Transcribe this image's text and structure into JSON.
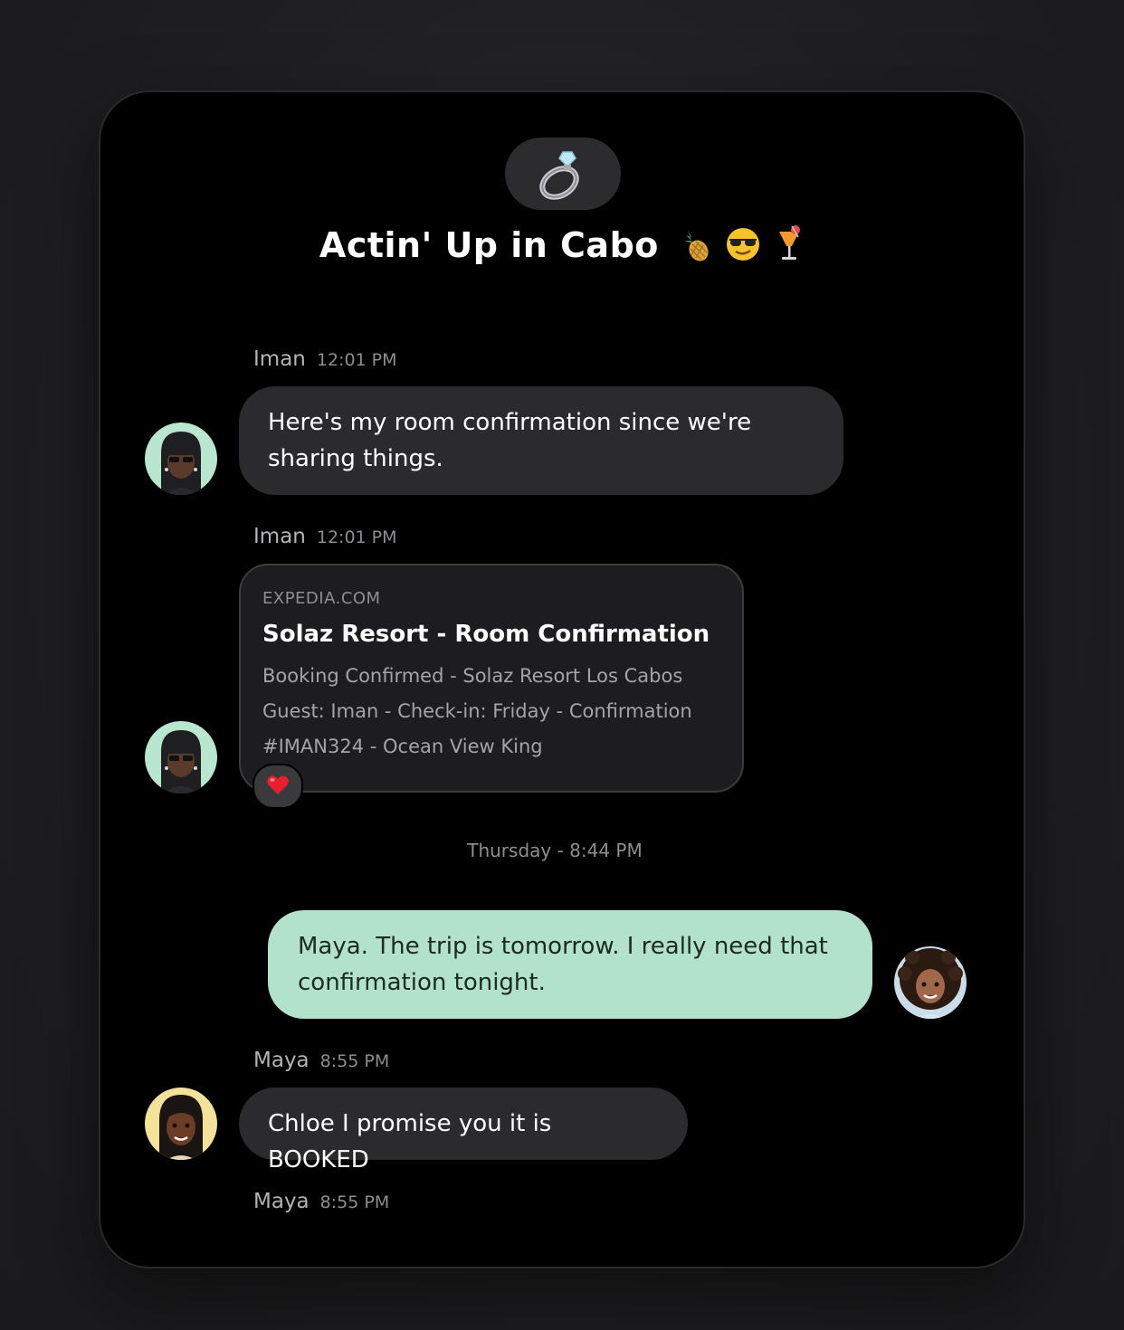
{
  "chat": {
    "group_icon": "ring-icon",
    "title": "Actin' Up in Cabo",
    "title_emojis": [
      "pineapple-icon",
      "sunglasses-face-icon",
      "tropical-drink-icon"
    ]
  },
  "messages": [
    {
      "sender": "Iman",
      "time": "12:01 PM",
      "direction": "incoming",
      "text_lines": [
        "Here's my room confirmation since we're",
        "sharing things."
      ]
    },
    {
      "sender": "Iman",
      "time": "12:01 PM",
      "direction": "incoming",
      "link_preview": {
        "source": "EXPEDIA.COM",
        "title": "Solaz Resort - Room Confirmation",
        "desc_lines": [
          "Booking Confirmed - Solaz Resort Los Cabos",
          "Guest: Iman - Check-in: Friday - Confirmation",
          "#IMAN324 - Ocean View King"
        ]
      },
      "reaction": "heart-icon"
    },
    {
      "day_separator": "Thursday - 8:44 PM"
    },
    {
      "direction": "outgoing",
      "text_lines": [
        "Maya. The trip is tomorrow. I really need that",
        "confirmation tonight."
      ]
    },
    {
      "sender": "Maya",
      "time": "8:55 PM",
      "direction": "incoming",
      "text": "Chloe I promise you it is BOOKED"
    },
    {
      "sender": "Maya",
      "time": "8:55 PM"
    }
  ],
  "colors": {
    "outgoing_bubble": "#b2e2cc",
    "incoming_bubble": "#2b2b2e",
    "iman_avatar_bg": "#b9e6cf",
    "maya_avatar_bg": "#f4e29a"
  }
}
